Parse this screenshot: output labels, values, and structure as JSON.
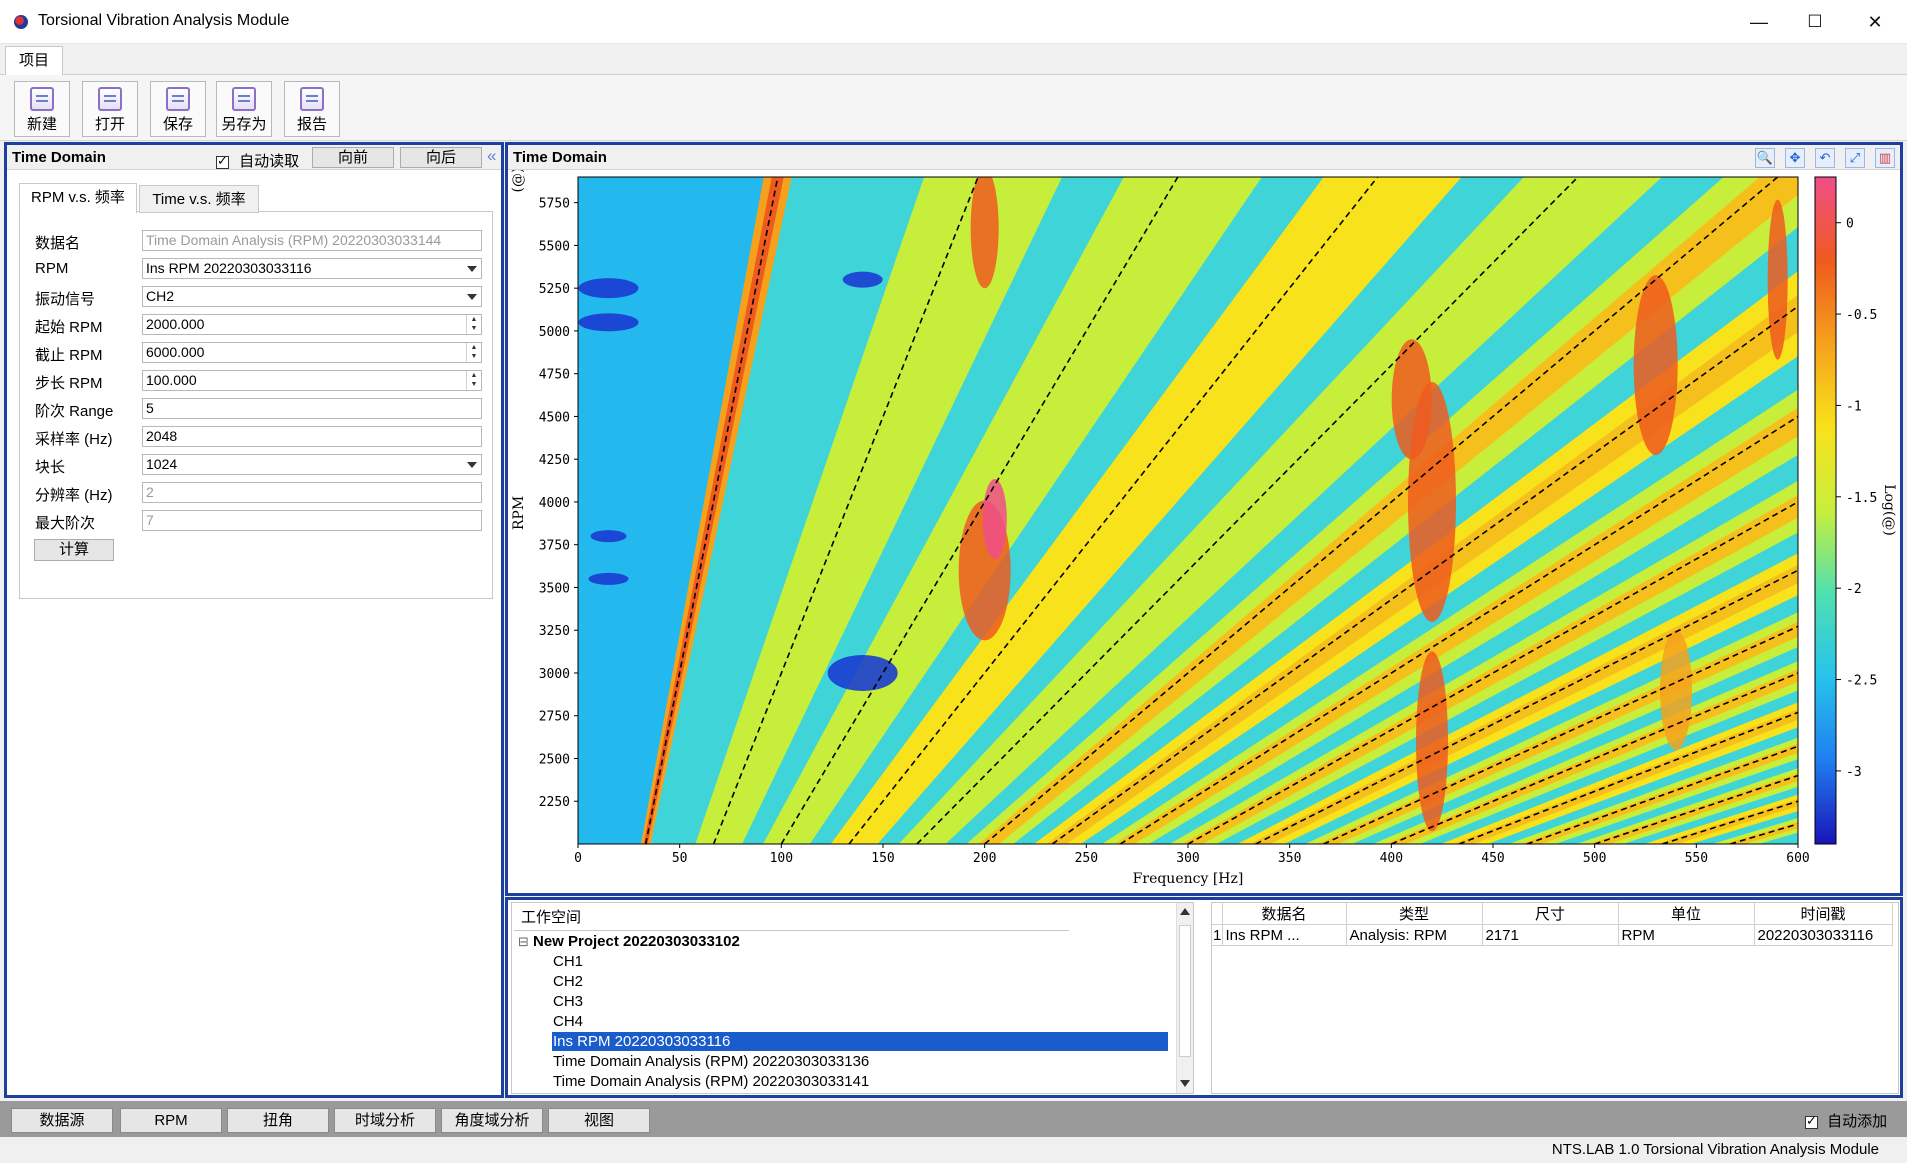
{
  "window": {
    "title": "Torsional Vibration Analysis Module",
    "minimize": "—",
    "maximize": "☐",
    "close": "✕"
  },
  "menu": {
    "project": "项目"
  },
  "toolbar": [
    {
      "label": "新建",
      "icon": "new-file-icon"
    },
    {
      "label": "打开",
      "icon": "open-folder-icon"
    },
    {
      "label": "保存",
      "icon": "save-icon"
    },
    {
      "label": "另存为",
      "icon": "save-as-icon"
    },
    {
      "label": "报告",
      "icon": "report-icon"
    }
  ],
  "left_panel": {
    "title": "Time Domain",
    "auto_read_label": "自动读取",
    "auto_read_checked": true,
    "prev_label": "向前",
    "next_label": "向后",
    "collapse_glyph": "«",
    "tabs": [
      "RPM v.s. 频率",
      "Time v.s. 频率"
    ],
    "fields": [
      {
        "label": "数据名",
        "value": "Time Domain Analysis (RPM) 20220303033144",
        "kind": "text",
        "disabled": true
      },
      {
        "label": "RPM",
        "value": "Ins RPM 20220303033116",
        "kind": "dropdown"
      },
      {
        "label": "振动信号",
        "value": "CH2",
        "kind": "dropdown"
      },
      {
        "label": "起始 RPM",
        "value": "2000.000",
        "kind": "spin"
      },
      {
        "label": "截止 RPM",
        "value": "6000.000",
        "kind": "spin"
      },
      {
        "label": "步长 RPM",
        "value": "100.000",
        "kind": "spin"
      },
      {
        "label": "阶次 Range",
        "value": "5",
        "kind": "text"
      },
      {
        "label": "采样率 (Hz)",
        "value": "2048",
        "kind": "text"
      },
      {
        "label": "块长",
        "value": "1024",
        "kind": "dropdown"
      },
      {
        "label": "分辨率 (Hz)",
        "value": "2",
        "kind": "text",
        "disabled": true
      },
      {
        "label": "最大阶次",
        "value": "7",
        "kind": "text",
        "disabled": true
      }
    ],
    "compute_label": "计算"
  },
  "chart_panel": {
    "title": "Time Domain",
    "tools": [
      "zoom-icon",
      "pan-icon",
      "reset-icon",
      "axis-icon",
      "chart-icon"
    ],
    "tool_glyphs": [
      "🔍",
      "✥",
      "↶",
      "⤢",
      "▥"
    ]
  },
  "chart_data": {
    "type": "heatmap",
    "xlabel": "Frequency [Hz]",
    "ylabel": "RPM",
    "y_unit_symbol": "(@)",
    "colorbar_label": "Log(@)",
    "xlim": [
      0,
      600
    ],
    "ylim": [
      2000,
      5900
    ],
    "x_ticks": [
      0,
      50,
      100,
      150,
      200,
      250,
      300,
      350,
      400,
      450,
      500,
      550,
      600
    ],
    "y_ticks": [
      2250,
      2500,
      2750,
      3000,
      3250,
      3500,
      3750,
      4000,
      4250,
      4500,
      4750,
      5000,
      5250,
      5500,
      5750
    ],
    "colorbar_range": [
      -3.4,
      0.25
    ],
    "colorbar_ticks": [
      0,
      -0.5,
      -1,
      -1.5,
      -2,
      -2.5,
      -3
    ],
    "colorbar_tick_labels": [
      "0",
      "-0.5",
      "-1",
      "-1.5",
      "-2",
      "-2.5",
      "-3"
    ],
    "order_lines_hz_at_2000rpm": [
      33.3,
      66.7,
      100,
      133.3,
      166.7,
      200,
      233.3,
      266.7,
      300,
      333.3,
      366.7,
      400,
      433.3,
      466.7,
      500,
      533.3,
      566.7
    ],
    "orders": [
      1,
      2,
      3,
      4,
      5,
      6,
      7,
      8,
      9,
      10,
      11,
      12,
      13,
      14,
      15,
      16,
      17
    ],
    "colormap": [
      "#1a14b8",
      "#1f7ef0",
      "#27c3ec",
      "#4fe0b0",
      "#c8ee3c",
      "#f8e21c",
      "#f6a11c",
      "#ef5a1f",
      "#f04e8a"
    ]
  },
  "workspace": {
    "header": "工作空间",
    "project": "New Project 20220303033102",
    "items": [
      "CH1",
      "CH2",
      "CH3",
      "CH4",
      "Ins RPM 20220303033116",
      "Time Domain Analysis (RPM) 20220303033136",
      "Time Domain Analysis (RPM) 20220303033141"
    ],
    "selected_index": 4,
    "expander": "⊟"
  },
  "data_table": {
    "columns": [
      "数据名",
      "类型",
      "尺寸",
      "单位",
      "时间戳"
    ],
    "rows": [
      {
        "index": "1",
        "cells": [
          "Ins RPM ...",
          "Analysis: RPM",
          "2171",
          "RPM",
          "20220303033116"
        ]
      }
    ]
  },
  "bottom_tabs": [
    "数据源",
    "RPM",
    "扭角",
    "时域分析",
    "角度域分析",
    "视图"
  ],
  "auto_add_label": "自动添加",
  "auto_add_checked": true,
  "status": "NTS.LAB 1.0 Torsional Vibration Analysis Module"
}
